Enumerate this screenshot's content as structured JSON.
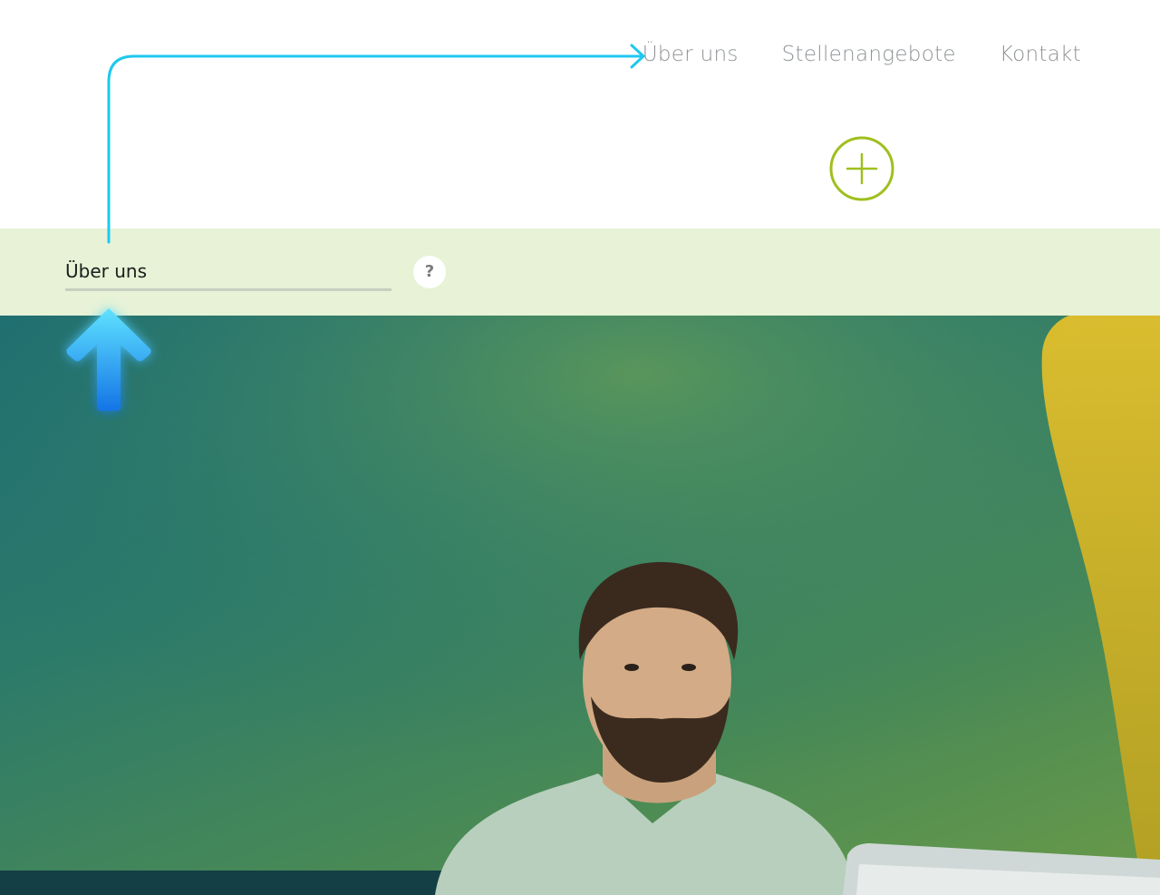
{
  "nav": {
    "items": [
      {
        "label": "Über uns"
      },
      {
        "label": "Stellenangebote"
      },
      {
        "label": "Kontakt"
      }
    ]
  },
  "add_button": {
    "icon": "plus-icon",
    "color": "#9fbf1e"
  },
  "field": {
    "value": "Über uns"
  },
  "help": {
    "label": "?"
  },
  "hero": {
    "image": "photo-of-man-at-laptop",
    "tint": "green-teal-gradient"
  },
  "annotations": {
    "arrow_color": "#1ec8f0",
    "connector": "curved-arrow-icon",
    "pointer": "up-arrow-icon"
  }
}
